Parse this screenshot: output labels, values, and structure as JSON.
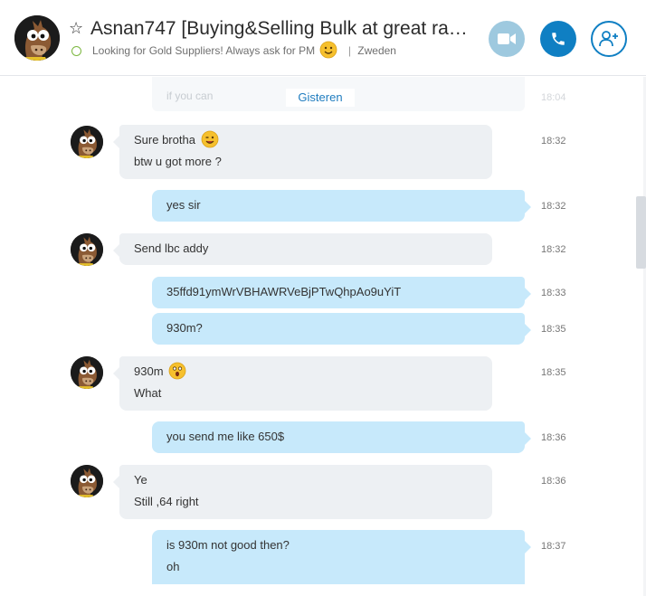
{
  "contact": {
    "name": "Asnan747 [Buying&Selling Bulk at great rat…",
    "mood": "Looking for Gold Suppliers!  Always ask for PM",
    "location": "Zweden"
  },
  "header_buttons": {
    "video": "video-call-icon",
    "call": "phone-icon",
    "add": "add-contact-icon"
  },
  "ghost_message": {
    "text": "if you can",
    "time": "18:04"
  },
  "date_separator": "Gisteren",
  "messages": [
    {
      "dir": "in",
      "lines": [
        "Sure brotha",
        "btw u got more ?"
      ],
      "emoji": "wink",
      "time": "18:32"
    },
    {
      "dir": "out",
      "lines": [
        "yes sir"
      ],
      "time": "18:32"
    },
    {
      "dir": "in",
      "lines": [
        "Send lbc addy"
      ],
      "time": "18:32"
    },
    {
      "dir": "out",
      "lines": [
        "35ffd91ymWrVBHAWRVeBjPTwQhpAo9uYiT"
      ],
      "time": "18:33"
    },
    {
      "dir": "out",
      "lines": [
        "930m?"
      ],
      "time": "18:35"
    },
    {
      "dir": "in",
      "lines": [
        "930m",
        "What"
      ],
      "emoji": "surprised",
      "time": "18:35"
    },
    {
      "dir": "out",
      "lines": [
        "you send me like 650$"
      ],
      "time": "18:36"
    },
    {
      "dir": "in",
      "lines": [
        "Ye",
        "Still ,64 right"
      ],
      "time": "18:36"
    },
    {
      "dir": "out",
      "lines": [
        "is 930m not good then?",
        "oh"
      ],
      "time": "18:37"
    }
  ],
  "colors": {
    "accent": "#0f7fc3",
    "video_button": "#9ec9df",
    "incoming_bubble": "#edf0f3",
    "outgoing_bubble": "#c7e9fb",
    "online": "#7cb740"
  }
}
